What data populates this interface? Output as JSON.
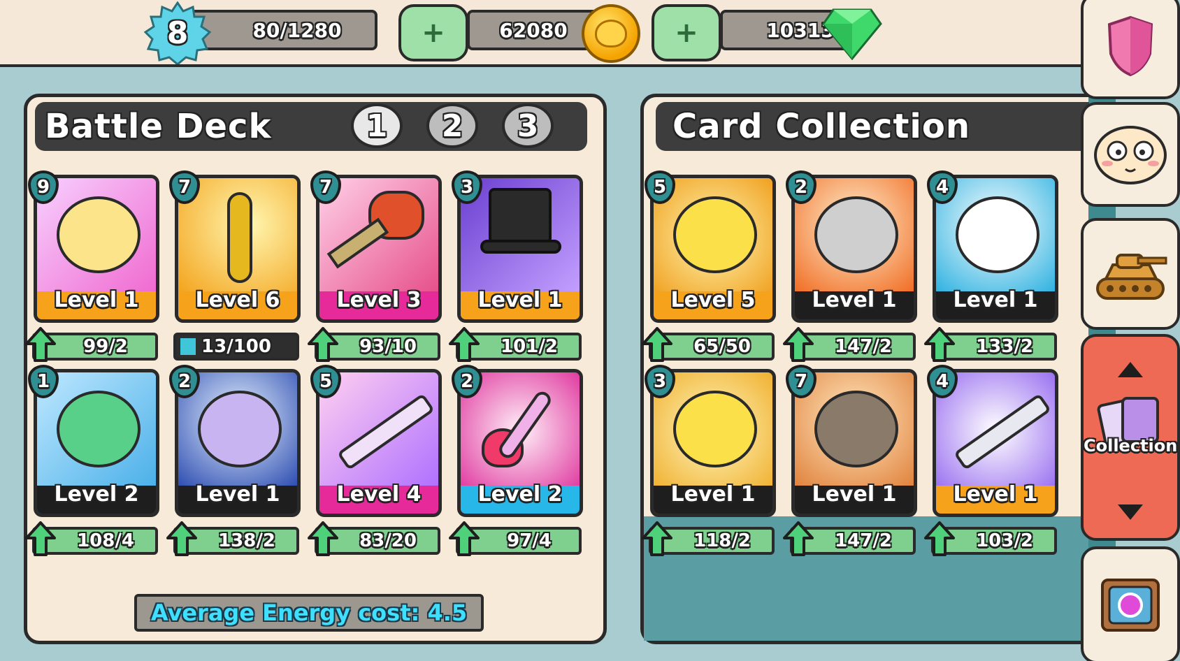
{
  "top_bar": {
    "player_level": "8",
    "xp": "80/1280",
    "coins": "62080",
    "gems": "10313",
    "add_coins_label": "+",
    "add_gems_label": "+"
  },
  "battle_deck": {
    "title": "Battle Deck",
    "tabs": [
      "1",
      "2",
      "3"
    ],
    "active_tab": "1",
    "cards": [
      {
        "cost": "9",
        "level": "Level 1",
        "progress": "99/2",
        "rarity": "orange",
        "art": "yellow-blob"
      },
      {
        "cost": "7",
        "level": "Level 6",
        "progress": "13/100",
        "progress_fraction": 0.13,
        "rarity": "orange",
        "art": "hook"
      },
      {
        "cost": "7",
        "level": "Level 3",
        "progress": "93/10",
        "rarity": "pink",
        "art": "boxing-glove"
      },
      {
        "cost": "3",
        "level": "Level 1",
        "progress": "101/2",
        "rarity": "orange",
        "art": "top-hat"
      },
      {
        "cost": "1",
        "level": "Level 2",
        "progress": "108/4",
        "rarity": "black",
        "art": "frog"
      },
      {
        "cost": "2",
        "level": "Level 1",
        "progress": "138/2",
        "rarity": "black",
        "art": "spider-gem"
      },
      {
        "cost": "5",
        "level": "Level 4",
        "progress": "83/20",
        "rarity": "pink",
        "art": "revolver"
      },
      {
        "cost": "2",
        "level": "Level 2",
        "progress": "97/4",
        "rarity": "blue",
        "art": "heart-wand"
      }
    ],
    "average_energy": "Average Energy cost: 4.5"
  },
  "card_collection": {
    "title": "Card Collection",
    "cards": [
      {
        "cost": "5",
        "level": "Level 5",
        "progress": "65/50",
        "rarity": "orange",
        "art": "chick"
      },
      {
        "cost": "2",
        "level": "Level 1",
        "progress": "147/2",
        "rarity": "black",
        "art": "bomb-3"
      },
      {
        "cost": "4",
        "level": "Level 1",
        "progress": "133/2",
        "rarity": "black",
        "art": "cloud-chick"
      },
      {
        "cost": "3",
        "level": "Level 1",
        "progress": "118/2",
        "rarity": "black",
        "art": "chick-eggs"
      },
      {
        "cost": "7",
        "level": "Level 1",
        "progress": "147/2",
        "rarity": "black",
        "art": "bomb-4"
      },
      {
        "cost": "4",
        "level": "Level 1",
        "progress": "103/2",
        "rarity": "orange",
        "art": "salt-shaker"
      }
    ]
  },
  "sidebar": {
    "items": [
      {
        "name": "shield-icon"
      },
      {
        "name": "face-icon"
      },
      {
        "name": "tank-icon"
      },
      {
        "name": "collection",
        "label": "Collection"
      },
      {
        "name": "chest-icon"
      }
    ]
  },
  "colors": {
    "rarity_orange": "#f7a21b",
    "rarity_pink": "#e62a9a",
    "rarity_blue": "#27b7e8",
    "rarity_black": "#1e1e1e",
    "progress_green": "#7fd08e",
    "cost_teal": "#2f8f92"
  }
}
